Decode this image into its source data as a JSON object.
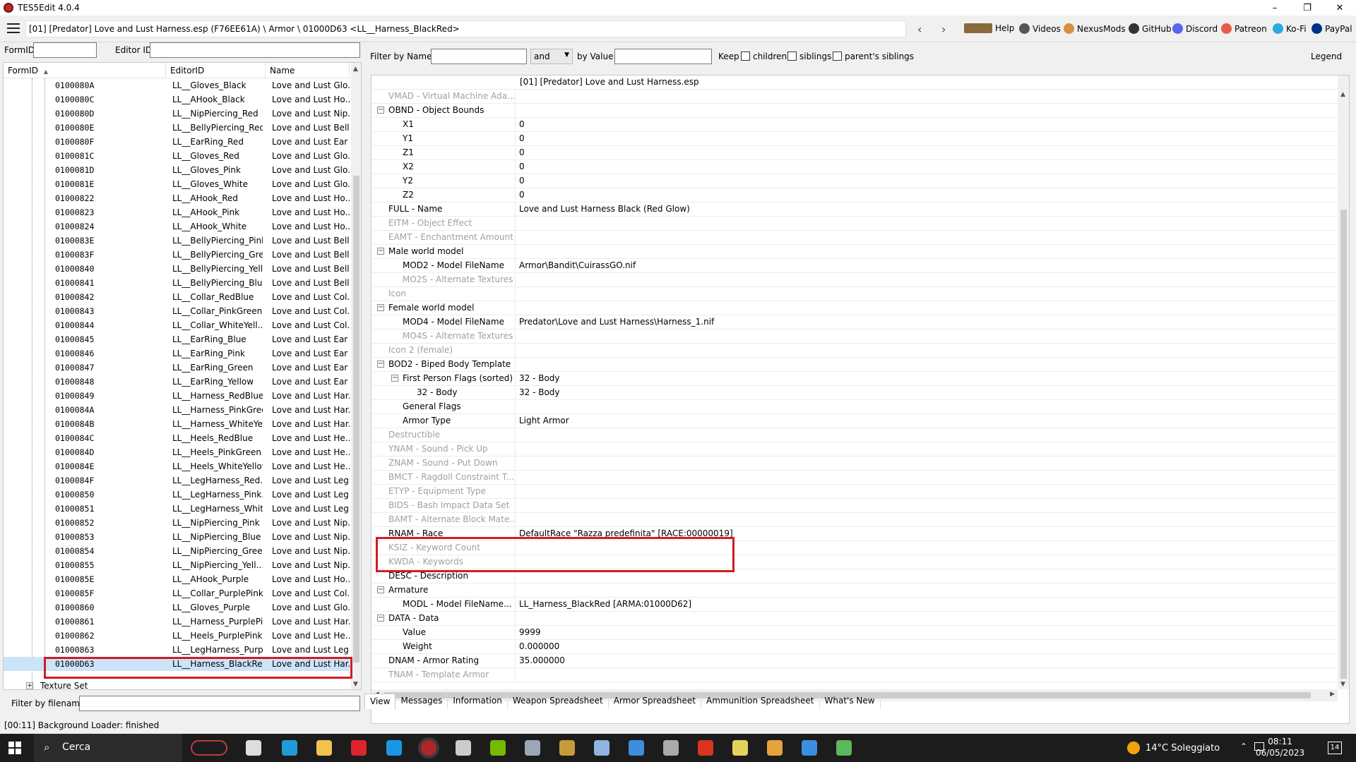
{
  "window": {
    "title": "TES5Edit 4.0.4",
    "controls": [
      "–",
      "❐",
      "✕"
    ]
  },
  "toolbar": {
    "path": "[01] [Predator] Love and Lust Harness.esp (F76EE61A) \\ Armor \\ 01000D63 <LL__Harness_BlackRed>",
    "back": "‹",
    "forward": "›",
    "links": [
      {
        "label": "Help",
        "icon": "book-icon",
        "color": "#8a6a3c"
      },
      {
        "label": "Videos",
        "icon": "video-icon",
        "color": "#555555"
      },
      {
        "label": "NexusMods",
        "icon": "nexusmods-icon",
        "color": "#d98f40"
      },
      {
        "label": "GitHub",
        "icon": "github-icon",
        "color": "#333333"
      },
      {
        "label": "Discord",
        "icon": "discord-icon",
        "color": "#5865f2"
      },
      {
        "label": "Patreon",
        "icon": "patreon-icon",
        "color": "#e85b46"
      },
      {
        "label": "Ko-Fi",
        "icon": "kofi-icon",
        "color": "#29abe0"
      },
      {
        "label": "PayPal",
        "icon": "paypal-icon",
        "color": "#003087"
      }
    ]
  },
  "left": {
    "formid_label": "FormID",
    "editorid_label": "Editor ID",
    "formid_value": "",
    "editorid_value": "",
    "columns": [
      "FormID",
      "EditorID",
      "Name"
    ],
    "rows": [
      {
        "formid": "0100080A",
        "editorid": "LL__Gloves_Black",
        "name": "Love and Lust Glo..."
      },
      {
        "formid": "0100080C",
        "editorid": "LL__AHook_Black",
        "name": "Love and Lust Ho..."
      },
      {
        "formid": "0100080D",
        "editorid": "LL__NipPiercing_Red",
        "name": "Love and Lust Nip..."
      },
      {
        "formid": "0100080E",
        "editorid": "LL__BellyPiercing_Red",
        "name": "Love and Lust Bell..."
      },
      {
        "formid": "0100080F",
        "editorid": "LL__EarRing_Red",
        "name": "Love and Lust Ear ..."
      },
      {
        "formid": "0100081C",
        "editorid": "LL__Gloves_Red",
        "name": "Love and Lust Glo..."
      },
      {
        "formid": "0100081D",
        "editorid": "LL__Gloves_Pink",
        "name": "Love and Lust Glo..."
      },
      {
        "formid": "0100081E",
        "editorid": "LL__Gloves_White",
        "name": "Love and Lust Glo..."
      },
      {
        "formid": "01000822",
        "editorid": "LL__AHook_Red",
        "name": "Love and Lust Ho..."
      },
      {
        "formid": "01000823",
        "editorid": "LL__AHook_Pink",
        "name": "Love and Lust Ho..."
      },
      {
        "formid": "01000824",
        "editorid": "LL__AHook_White",
        "name": "Love and Lust Ho..."
      },
      {
        "formid": "0100083E",
        "editorid": "LL__BellyPiercing_Pink",
        "name": "Love and Lust Bell..."
      },
      {
        "formid": "0100083F",
        "editorid": "LL__BellyPiercing_Gre...",
        "name": "Love and Lust Bell..."
      },
      {
        "formid": "01000840",
        "editorid": "LL__BellyPiercing_Yell...",
        "name": "Love and Lust Bell..."
      },
      {
        "formid": "01000841",
        "editorid": "LL__BellyPiercing_Blue",
        "name": "Love and Lust Bell..."
      },
      {
        "formid": "01000842",
        "editorid": "LL__Collar_RedBlue",
        "name": "Love and Lust Col..."
      },
      {
        "formid": "01000843",
        "editorid": "LL__Collar_PinkGreen",
        "name": "Love and Lust Col..."
      },
      {
        "formid": "01000844",
        "editorid": "LL__Collar_WhiteYell...",
        "name": "Love and Lust Col..."
      },
      {
        "formid": "01000845",
        "editorid": "LL__EarRing_Blue",
        "name": "Love and Lust Ear ..."
      },
      {
        "formid": "01000846",
        "editorid": "LL__EarRing_Pink",
        "name": "Love and Lust Ear ..."
      },
      {
        "formid": "01000847",
        "editorid": "LL__EarRing_Green",
        "name": "Love and Lust Ear ..."
      },
      {
        "formid": "01000848",
        "editorid": "LL__EarRing_Yellow",
        "name": "Love and Lust Ear ..."
      },
      {
        "formid": "01000849",
        "editorid": "LL__Harness_RedBlue",
        "name": "Love and Lust Har..."
      },
      {
        "formid": "0100084A",
        "editorid": "LL__Harness_PinkGreen",
        "name": "Love and Lust Har..."
      },
      {
        "formid": "0100084B",
        "editorid": "LL__Harness_WhiteYe...",
        "name": "Love and Lust Har..."
      },
      {
        "formid": "0100084C",
        "editorid": "LL__Heels_RedBlue",
        "name": "Love and Lust He..."
      },
      {
        "formid": "0100084D",
        "editorid": "LL__Heels_PinkGreen",
        "name": "Love and Lust He..."
      },
      {
        "formid": "0100084E",
        "editorid": "LL__Heels_WhiteYellow",
        "name": "Love and Lust He..."
      },
      {
        "formid": "0100084F",
        "editorid": "LL__LegHarness_Red...",
        "name": "Love and Lust Leg..."
      },
      {
        "formid": "01000850",
        "editorid": "LL__LegHarness_Pink...",
        "name": "Love and Lust Leg..."
      },
      {
        "formid": "01000851",
        "editorid": "LL__LegHarness_Whit...",
        "name": "Love and Lust Leg..."
      },
      {
        "formid": "01000852",
        "editorid": "LL__NipPiercing_Pink",
        "name": "Love and Lust Nip..."
      },
      {
        "formid": "01000853",
        "editorid": "LL__NipPiercing_Blue",
        "name": "Love and Lust Nip..."
      },
      {
        "formid": "01000854",
        "editorid": "LL__NipPiercing_Green",
        "name": "Love and Lust Nip..."
      },
      {
        "formid": "01000855",
        "editorid": "LL__NipPiercing_Yell...",
        "name": "Love and Lust Nip..."
      },
      {
        "formid": "0100085E",
        "editorid": "LL__AHook_Purple",
        "name": "Love and Lust Ho..."
      },
      {
        "formid": "0100085F",
        "editorid": "LL__Collar_PurplePink",
        "name": "Love and Lust Col..."
      },
      {
        "formid": "01000860",
        "editorid": "LL__Gloves_Purple",
        "name": "Love and Lust Glo..."
      },
      {
        "formid": "01000861",
        "editorid": "LL__Harness_PurplePi...",
        "name": "Love and Lust Har..."
      },
      {
        "formid": "01000862",
        "editorid": "LL__Heels_PurplePink",
        "name": "Love and Lust He..."
      },
      {
        "formid": "01000863",
        "editorid": "LL__LegHarness_Purp...",
        "name": "Love and Lust Leg..."
      },
      {
        "formid": "01000D63",
        "editorid": "LL__Harness_BlackRed",
        "name": "Love and Lust Har...",
        "selected": true
      }
    ],
    "texture_set": "Texture Set",
    "filter_filename_label": "Filter by filename:",
    "filter_filename_value": ""
  },
  "right": {
    "filter_name_label": "Filter by Name:",
    "filter_name_value": "",
    "operator": "and",
    "by_value_label": "by Value:",
    "by_value_value": "",
    "keep_label": "Keep",
    "checkboxes": [
      "children",
      "siblings",
      "parent's siblings"
    ],
    "legend": "Legend",
    "header_value": "[01] [Predator] Love and Lust Harness.esp",
    "rows": [
      {
        "key": "VMAD - Virtual Machine Ada...",
        "value": "",
        "indent": 0,
        "grey": true
      },
      {
        "key": "OBND - Object Bounds",
        "value": "",
        "indent": 0,
        "expander": "⊟"
      },
      {
        "key": "X1",
        "value": "0",
        "indent": 1
      },
      {
        "key": "Y1",
        "value": "0",
        "indent": 1
      },
      {
        "key": "Z1",
        "value": "0",
        "indent": 1
      },
      {
        "key": "X2",
        "value": "0",
        "indent": 1
      },
      {
        "key": "Y2",
        "value": "0",
        "indent": 1
      },
      {
        "key": "Z2",
        "value": "0",
        "indent": 1
      },
      {
        "key": "FULL - Name",
        "value": "Love and Lust Harness Black (Red Glow)",
        "indent": 0
      },
      {
        "key": "EITM - Object Effect",
        "value": "",
        "indent": 0,
        "grey": true
      },
      {
        "key": "EAMT - Enchantment Amount",
        "value": "",
        "indent": 0,
        "grey": true
      },
      {
        "key": "Male world model",
        "value": "",
        "indent": 0,
        "expander": "⊟"
      },
      {
        "key": "MOD2 - Model FileName",
        "value": "Armor\\Bandit\\CuirassGO.nif",
        "indent": 1
      },
      {
        "key": "MO2S - Alternate Textures",
        "value": "",
        "indent": 1,
        "grey": true
      },
      {
        "key": "Icon",
        "value": "",
        "indent": 0,
        "grey": true
      },
      {
        "key": "Female world model",
        "value": "",
        "indent": 0,
        "expander": "⊟"
      },
      {
        "key": "MOD4 - Model FileName",
        "value": "Predator\\Love and Lust Harness\\Harness_1.nif",
        "indent": 1
      },
      {
        "key": "MO4S - Alternate Textures",
        "value": "",
        "indent": 1,
        "grey": true
      },
      {
        "key": "Icon 2 (female)",
        "value": "",
        "indent": 0,
        "grey": true
      },
      {
        "key": "BOD2 - Biped Body Template",
        "value": "",
        "indent": 0,
        "expander": "⊟"
      },
      {
        "key": "First Person Flags (sorted)",
        "value": "32 - Body",
        "indent": 1,
        "expander": "⊟"
      },
      {
        "key": "32 - Body",
        "value": "32 - Body",
        "indent": 2
      },
      {
        "key": "General Flags",
        "value": "",
        "indent": 1
      },
      {
        "key": "Armor Type",
        "value": "Light Armor",
        "indent": 1
      },
      {
        "key": "Destructible",
        "value": "",
        "indent": 0,
        "grey": true
      },
      {
        "key": "YNAM - Sound - Pick Up",
        "value": "",
        "indent": 0,
        "grey": true
      },
      {
        "key": "ZNAM - Sound - Put Down",
        "value": "",
        "indent": 0,
        "grey": true
      },
      {
        "key": "BMCT - Ragdoll Constraint T...",
        "value": "",
        "indent": 0,
        "grey": true
      },
      {
        "key": "ETYP - Equipment Type",
        "value": "",
        "indent": 0,
        "grey": true
      },
      {
        "key": "BIDS - Bash Impact Data Set",
        "value": "",
        "indent": 0,
        "grey": true
      },
      {
        "key": "BAMT - Alternate Block Mate...",
        "value": "",
        "indent": 0,
        "grey": true
      },
      {
        "key": "RNAM - Race",
        "value": "DefaultRace \"Razza predefinita\" [RACE:00000019]",
        "indent": 0
      },
      {
        "key": "KSIZ - Keyword Count",
        "value": "",
        "indent": 0,
        "grey": true
      },
      {
        "key": "KWDA - Keywords",
        "value": "",
        "indent": 0,
        "grey": true
      },
      {
        "key": "DESC - Description",
        "value": "",
        "indent": 0
      },
      {
        "key": "Armature",
        "value": "",
        "indent": 0,
        "expander": "⊟"
      },
      {
        "key": "MODL - Model FileName...",
        "value": "LL_Harness_BlackRed [ARMA:01000D62]",
        "indent": 1
      },
      {
        "key": "DATA - Data",
        "value": "",
        "indent": 0,
        "expander": "⊟"
      },
      {
        "key": "Value",
        "value": "9999",
        "indent": 1
      },
      {
        "key": "Weight",
        "value": "0.000000",
        "indent": 1
      },
      {
        "key": "DNAM - Armor Rating",
        "value": "35.000000",
        "indent": 0
      },
      {
        "key": "TNAM - Template Armor",
        "value": "",
        "indent": 0,
        "grey": true
      }
    ],
    "tabs": [
      "View",
      "Messages",
      "Information",
      "Weapon Spreadsheet",
      "Armor Spreadsheet",
      "Ammunition Spreadsheet",
      "What's New"
    ],
    "active_tab": "View"
  },
  "status": "[00:11] Background Loader: finished",
  "taskbar": {
    "search": "Cerca",
    "weather": "14°C Soleggiato",
    "time": "08:11",
    "date": "06/05/2023",
    "notifications": "14",
    "apps": [
      {
        "icon": "bicycle-icon",
        "color": "#c23b3b"
      },
      {
        "icon": "task-view-icon",
        "color": "#dddddd"
      },
      {
        "icon": "edge-icon",
        "color": "#1f9bd8"
      },
      {
        "icon": "file-explorer-icon",
        "color": "#f2c14e"
      },
      {
        "icon": "opera-icon",
        "color": "#e0232e"
      },
      {
        "icon": "skype-icon",
        "color": "#1a96e8"
      },
      {
        "icon": "tes5edit-icon",
        "color": "#b0252b"
      },
      {
        "icon": "game-icon",
        "color": "#cccccc"
      },
      {
        "icon": "nvidia-icon",
        "color": "#76b900"
      },
      {
        "icon": "steam-icon",
        "color": "#9aa7b4"
      },
      {
        "icon": "app-icon",
        "color": "#c79a3a"
      },
      {
        "icon": "pen-icon",
        "color": "#8fb5e0"
      },
      {
        "icon": "window-icon",
        "color": "#3d8ee0"
      },
      {
        "icon": "calculator-icon",
        "color": "#aaaaaa"
      },
      {
        "icon": "filezilla-icon",
        "color": "#d9341f"
      },
      {
        "icon": "notepad-icon",
        "color": "#e6d25a"
      },
      {
        "icon": "arrow-icon",
        "color": "#e6a23c"
      },
      {
        "icon": "window2-icon",
        "color": "#3d8ee0"
      },
      {
        "icon": "spreadsheet-icon",
        "color": "#5cb85c"
      }
    ]
  }
}
